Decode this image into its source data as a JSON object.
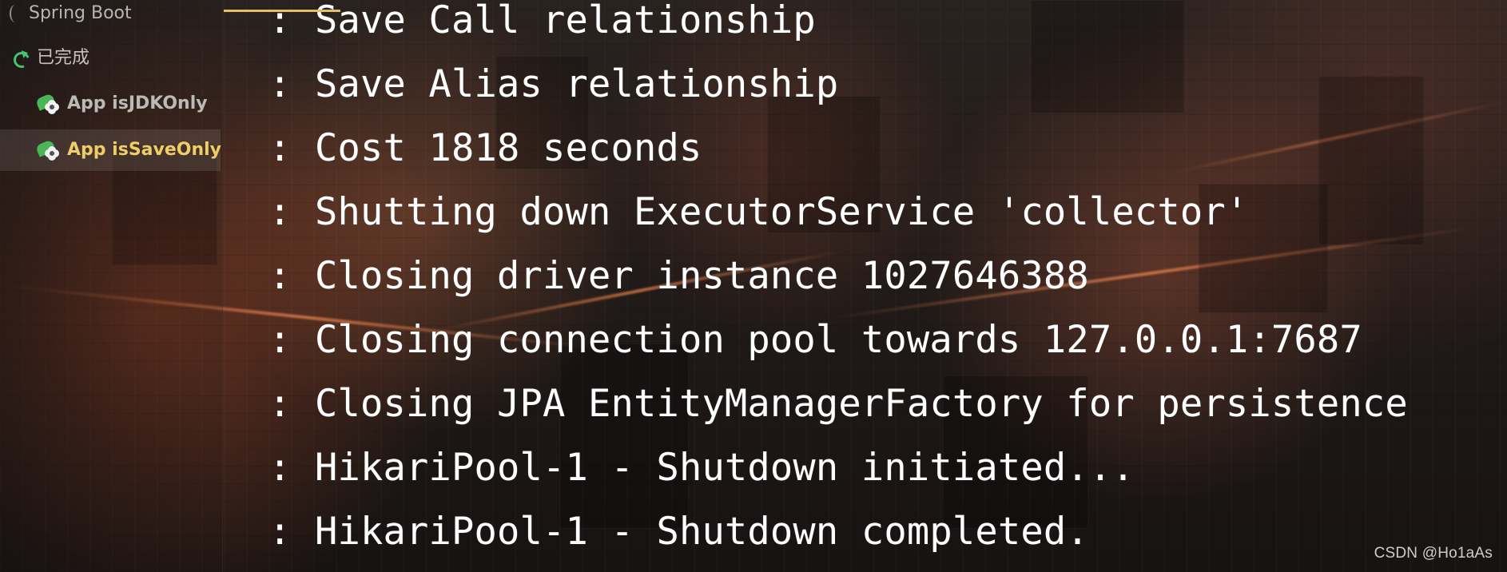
{
  "sidebar": {
    "items": [
      {
        "label": "Spring Boot"
      },
      {
        "label": "已完成"
      },
      {
        "label": "App isJDKOnly"
      },
      {
        "label": "App isSaveOnly"
      }
    ]
  },
  "console": {
    "prefix": ":",
    "lines": [
      "Save Call relationship",
      "Save Alias relationship",
      "Cost 1818 seconds",
      "Shutting down ExecutorService 'collector'",
      "Closing driver instance 1027646388",
      "Closing connection pool towards 127.0.0.1:7687",
      "Closing JPA EntityManagerFactory for persistence",
      "HikariPool-1 - Shutdown initiated...",
      "HikariPool-1 - Shutdown completed."
    ]
  },
  "watermark": {
    "text": "CSDN @Ho1aAs"
  },
  "colors": {
    "selected_text": "#f0cd66",
    "success_icon": "#47c46f",
    "spring_leaf": "#49b657",
    "tab_highlight": "#e6bf64"
  }
}
